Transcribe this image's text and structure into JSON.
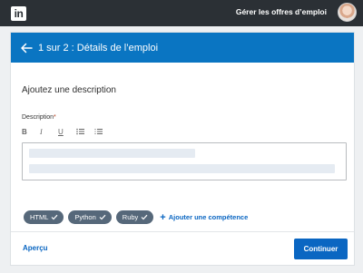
{
  "topnav": {
    "logo_text": "in",
    "manage_jobs_link": "Gérer les offres d’emploi",
    "avatar_icon": "user-avatar"
  },
  "card": {
    "header": {
      "back_icon": "arrow-left-icon",
      "title": "1 sur 2 : Détails de l’emploi"
    },
    "section_title": "Ajoutez une description",
    "description": {
      "label": "Description",
      "required_mark": "*",
      "toolbar": {
        "bold": "B",
        "italic": "I",
        "underline": "U",
        "bullet_list_icon": "bulleted-list-icon",
        "numbered_list_icon": "numbered-list-icon"
      }
    },
    "skills": [
      {
        "label": "HTML"
      },
      {
        "label": "Python"
      },
      {
        "label": "Ruby"
      }
    ],
    "add_skill": "Ajouter une compétence",
    "footer": {
      "preview": "Aperçu",
      "continue": "Continuer"
    }
  },
  "colors": {
    "nav_bg": "#2b3035",
    "header_blue": "#0a75c2",
    "link_blue": "#0a66c2",
    "pill_bg": "#56687a"
  }
}
